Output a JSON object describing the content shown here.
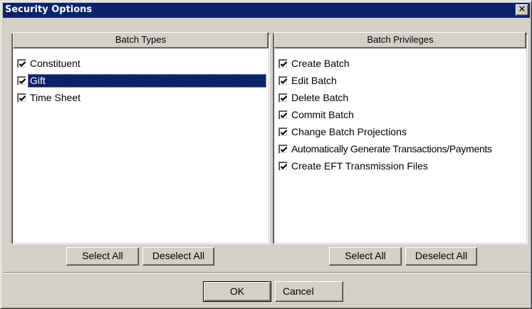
{
  "window": {
    "title": "Security Options",
    "close_glyph": "✕"
  },
  "batch_types": {
    "header": "Batch Types",
    "items": [
      {
        "label": "Constituent",
        "checked": true,
        "selected": false
      },
      {
        "label": "Gift",
        "checked": true,
        "selected": true
      },
      {
        "label": "Time Sheet",
        "checked": true,
        "selected": false
      }
    ],
    "select_all_label": "Select All",
    "deselect_all_label": "Deselect All"
  },
  "batch_privileges": {
    "header": "Batch Privileges",
    "items": [
      {
        "label": "Create Batch",
        "checked": true
      },
      {
        "label": "Edit Batch",
        "checked": true
      },
      {
        "label": "Delete Batch",
        "checked": true
      },
      {
        "label": "Commit Batch",
        "checked": true
      },
      {
        "label": "Change Batch Projections",
        "checked": true
      },
      {
        "label": "Automatically Generate Transactions/Payments",
        "checked": true
      },
      {
        "label": "Create EFT Transmission Files",
        "checked": true
      }
    ],
    "select_all_label": "Select All",
    "deselect_all_label": "Deselect All"
  },
  "footer": {
    "ok_label": "OK",
    "cancel_label": "Cancel"
  }
}
